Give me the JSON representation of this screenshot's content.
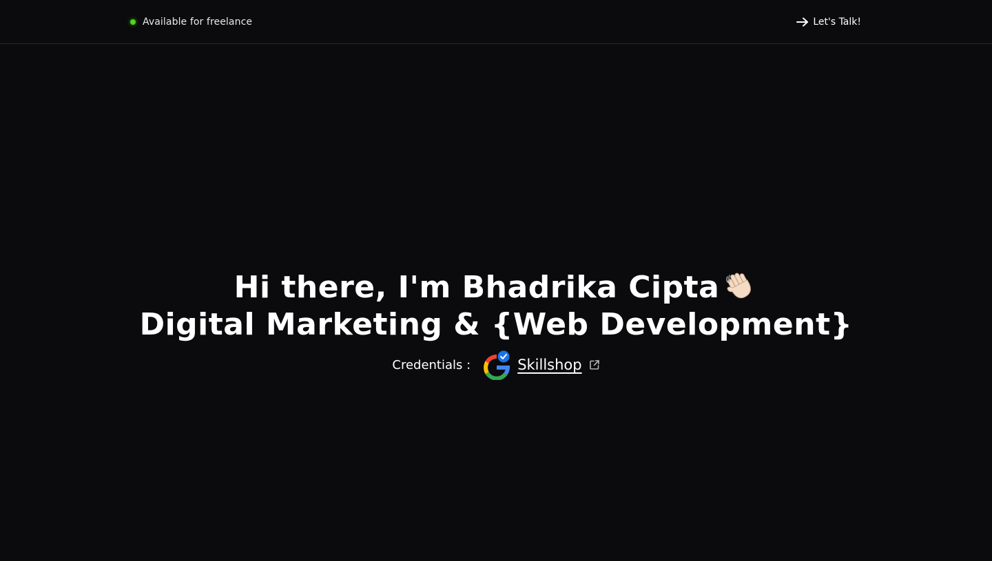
{
  "header": {
    "availability_text": "Available for freelance",
    "status_color": "#4fd61f",
    "cta_label": "Let's Talk!",
    "cta_icon": "arrow-right-icon"
  },
  "hero": {
    "line1": "Hi there, I'm Bhadrika Cipta",
    "line1_icon": "waving-hand-icon",
    "line2": "Digital Marketing & {Web Development}"
  },
  "credentials": {
    "label": "Credentials :",
    "badge_icon": "google-verified-icon",
    "link_text": "Skillshop",
    "link_icon": "external-link-icon"
  }
}
